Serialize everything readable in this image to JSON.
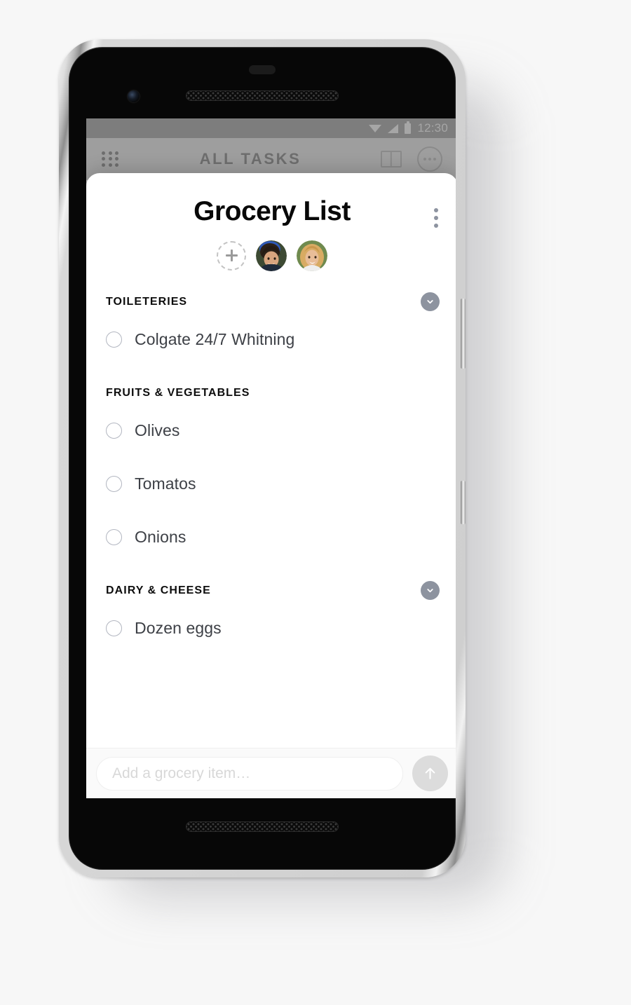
{
  "device": {
    "status_bar": {
      "time": "12:30",
      "icons": [
        "wifi-icon",
        "signal-icon",
        "battery-icon"
      ]
    },
    "hardware": {
      "front_camera": "front-camera",
      "earpiece": "earpiece-grille",
      "bottom_speaker": "bottom-speaker-grille",
      "power_button": "power-button",
      "volume_button": "volume-button"
    }
  },
  "background_app": {
    "title": "ALL TASKS",
    "menu_icon": "grid-menu-icon",
    "book_icon": "book-icon",
    "profile_icon": "profile-avatar-icon"
  },
  "sheet": {
    "title": "Grocery List",
    "overflow_icon": "more-vertical-icon",
    "members": {
      "add_label": "+",
      "add_icon": "plus-icon",
      "people": [
        {
          "name": "member-avatar-1",
          "hair": "#2b2017",
          "skin": "#d8a47e",
          "bg": "#3d4a33",
          "accent": "#2f59b8"
        },
        {
          "name": "member-avatar-2",
          "hair": "#d8ab63",
          "skin": "#e8bd98",
          "bg": "#6f8a4e",
          "accent": "#f2f2f2"
        }
      ]
    },
    "sections": [
      {
        "title": "TOILETERIES",
        "collapsible": true,
        "collapse_icon": "chevron-down-icon",
        "items": [
          {
            "label": "Colgate 24/7 Whitning",
            "checked": false
          }
        ]
      },
      {
        "title": "FRUITS & VEGETABLES",
        "collapsible": false,
        "collapse_icon": "",
        "items": [
          {
            "label": "Olives",
            "checked": false
          },
          {
            "label": "Tomatos",
            "checked": false
          },
          {
            "label": "Onions",
            "checked": false
          }
        ]
      },
      {
        "title": "DAIRY & CHEESE",
        "collapsible": true,
        "collapse_icon": "chevron-down-icon",
        "items": [
          {
            "label": "Dozen eggs",
            "checked": false
          }
        ]
      }
    ],
    "compose": {
      "placeholder": "Add a grocery item…",
      "value": "",
      "send_icon": "arrow-up-icon"
    }
  },
  "colors": {
    "accent_gray_blue": "#8d939f",
    "checkbox_border": "#b2b6c0",
    "text_primary": "#080808",
    "text_item": "#3d4046",
    "send_button_bg": "#dcdcdc",
    "sheet_bg": "#ffffff",
    "compose_bg": "#fafafa"
  }
}
